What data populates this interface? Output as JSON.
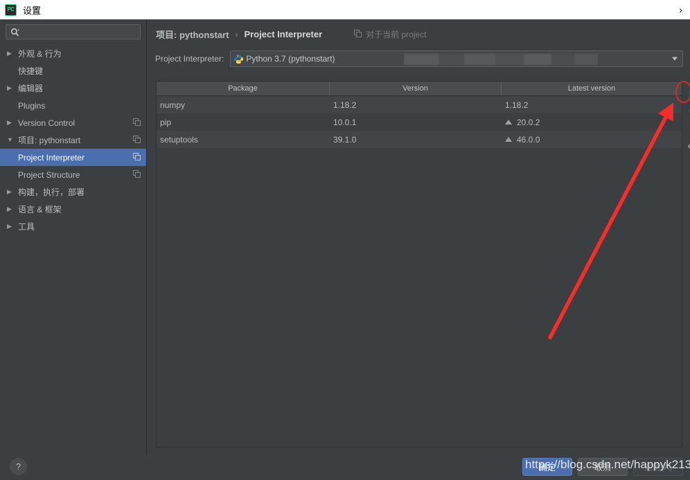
{
  "window": {
    "title": "设置",
    "app_icon": "pycharm-icon",
    "icon_text": "PC",
    "expand_chevron": "›"
  },
  "sidebar": {
    "search": {
      "value": "",
      "placeholder": "",
      "icon": "search-icon"
    },
    "items": [
      {
        "label": "外观 & 行为",
        "twisty": "▶",
        "indent": 0,
        "selected": false,
        "copy": false
      },
      {
        "label": "快捷键",
        "twisty": "",
        "indent": 0,
        "selected": false,
        "copy": false
      },
      {
        "label": "编辑器",
        "twisty": "▶",
        "indent": 0,
        "selected": false,
        "copy": false
      },
      {
        "label": "Plugins",
        "twisty": "",
        "indent": 0,
        "selected": false,
        "copy": false
      },
      {
        "label": "Version Control",
        "twisty": "▶",
        "indent": 0,
        "selected": false,
        "copy": true
      },
      {
        "label": "项目: pythonstart",
        "twisty": "▼",
        "indent": 0,
        "selected": false,
        "copy": true
      },
      {
        "label": "Project Interpreter",
        "twisty": "",
        "indent": 1,
        "selected": true,
        "copy": true
      },
      {
        "label": "Project Structure",
        "twisty": "",
        "indent": 1,
        "selected": false,
        "copy": true
      },
      {
        "label": "构建，执行，部署",
        "twisty": "▶",
        "indent": 0,
        "selected": false,
        "copy": false
      },
      {
        "label": "语言 & 框架",
        "twisty": "▶",
        "indent": 0,
        "selected": false,
        "copy": false
      },
      {
        "label": "工具",
        "twisty": "▶",
        "indent": 0,
        "selected": false,
        "copy": false
      }
    ]
  },
  "content": {
    "breadcrumb": {
      "project": "项目: pythonstart",
      "separator": "›",
      "page": "Project Interpreter",
      "scope_note": "对于当前 project",
      "scope_icon": "copy-icon"
    },
    "interpreter": {
      "label": "Project Interpreter:",
      "value": "Python 3.7 (pythonstart)",
      "icon": "python-icon",
      "path_redacted": true,
      "dropdown_icon": "chevron-down-icon",
      "settings_icon": "gear-icon"
    },
    "table": {
      "columns": [
        "Package",
        "Version",
        "Latest version"
      ],
      "rows": [
        {
          "package": "numpy",
          "version": "1.18.2",
          "latest": "1.18.2",
          "upgradable": false
        },
        {
          "package": "pip",
          "version": "10.0.1",
          "latest": "20.0.2",
          "upgradable": true
        },
        {
          "package": "setuptools",
          "version": "39.1.0",
          "latest": "46.0.0",
          "upgradable": true
        }
      ]
    },
    "toolbar": [
      {
        "name": "add-package-button",
        "icon": "plus-icon",
        "highlighted": true
      },
      {
        "name": "remove-package-button",
        "icon": "minus-icon",
        "highlighted": false
      },
      {
        "name": "upgrade-package-button",
        "icon": "triangle-up-icon",
        "highlighted": false
      },
      {
        "name": "show-early-releases-button",
        "icon": "eye-icon",
        "highlighted": false
      }
    ]
  },
  "footer": {
    "help_label": "?",
    "ok_label": "确定",
    "cancel_label": "取消",
    "apply_label": "应用(A)"
  },
  "annotations": {
    "watermark": "https://blog.csdn.net/happyk213",
    "arrow_color": "#fb2b28",
    "highlight_color": "#d42b26"
  },
  "colors": {
    "background": "#3c3f41",
    "selection": "#4b6eaf",
    "header": "#4a4d4f",
    "border": "#2b2b2b",
    "text": "#bbbbbb"
  }
}
